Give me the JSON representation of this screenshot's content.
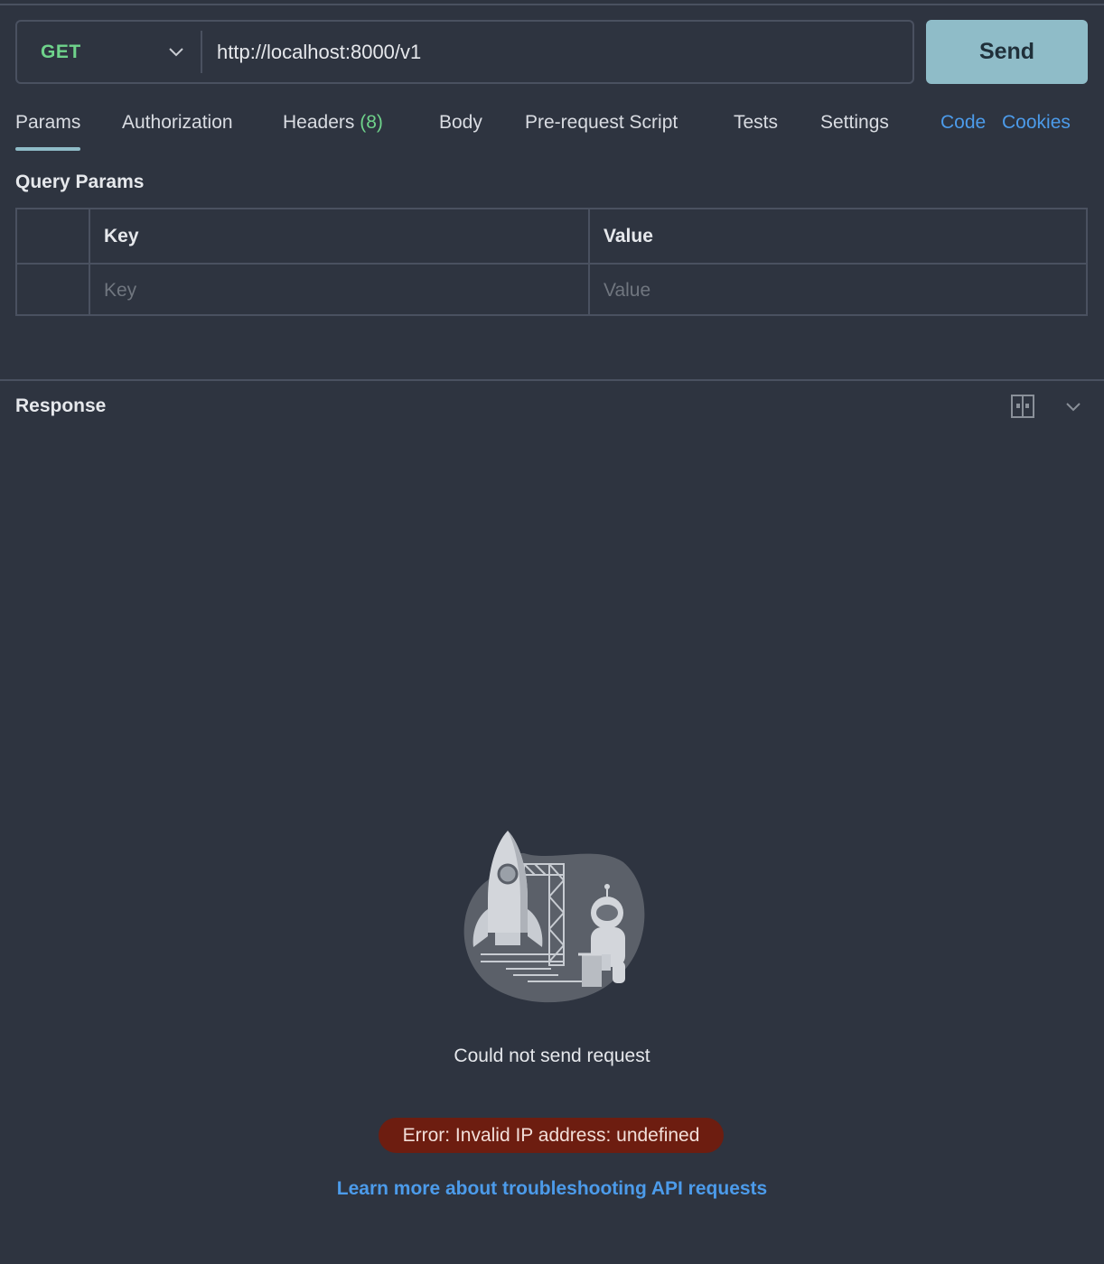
{
  "request": {
    "method": "GET",
    "url": "http://localhost:8000/v1",
    "send_label": "Send"
  },
  "tabs": [
    {
      "label": "Params",
      "active": true
    },
    {
      "label": "Authorization"
    },
    {
      "label": "Headers",
      "count": "(8)"
    },
    {
      "label": "Body"
    },
    {
      "label": "Pre-request Script"
    },
    {
      "label": "Tests"
    },
    {
      "label": "Settings"
    }
  ],
  "tab_links": {
    "code": "Code",
    "cookies": "Cookies"
  },
  "query_params": {
    "title": "Query Params",
    "columns": {
      "key": "Key",
      "value": "Value"
    },
    "placeholders": {
      "key": "Key",
      "value": "Value"
    }
  },
  "response": {
    "title": "Response",
    "message": "Could not send request",
    "error": "Error: Invalid IP address: undefined",
    "learn_more": "Learn more about troubleshooting API requests"
  },
  "icons": {
    "method_dropdown": "chevron-down-icon",
    "layout": "split-layout-icon",
    "collapse": "chevron-down-icon",
    "illustration": "rocket-astronaut-illustration"
  },
  "colors": {
    "background": "#2e3440",
    "method": "#6fd38b",
    "send_button": "#8fbcc8",
    "link": "#4c9bea",
    "error_badge": "#6d1d10"
  }
}
